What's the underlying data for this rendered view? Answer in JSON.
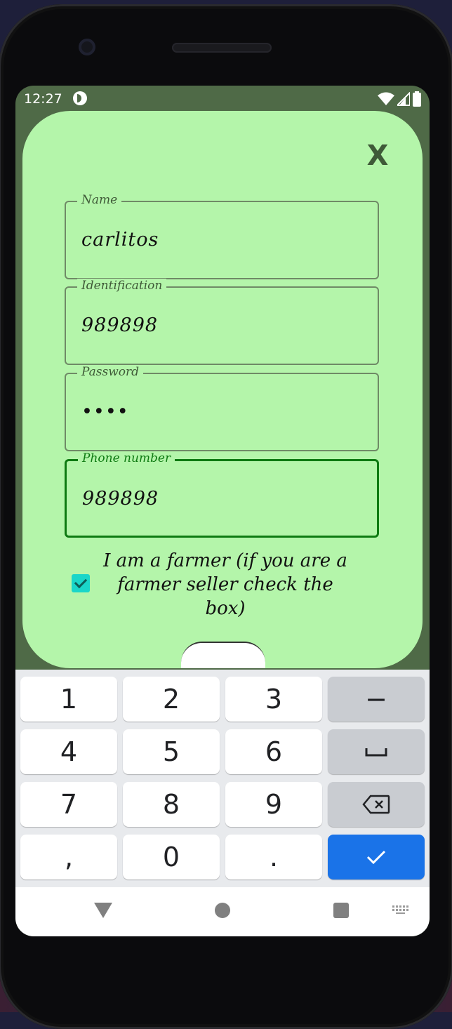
{
  "status_bar": {
    "time": "12:27"
  },
  "dialog": {
    "close_label": "X",
    "fields": [
      {
        "label": "Name",
        "value": "carlitos"
      },
      {
        "label": "Identification",
        "value": "989898"
      },
      {
        "label": "Password",
        "value": "••••"
      },
      {
        "label": "Phone number",
        "value": "989898"
      }
    ],
    "farmer_checkbox": {
      "checked": true,
      "label": "I am a farmer (if you are a farmer seller check the box)"
    }
  },
  "keyboard": {
    "rows": [
      [
        "1",
        "2",
        "3",
        "−"
      ],
      [
        "4",
        "5",
        "6",
        "␣"
      ],
      [
        "7",
        "8",
        "9",
        "⌫"
      ],
      [
        ",",
        "0",
        ".",
        "✓"
      ]
    ]
  },
  "colors": {
    "dialog_bg": "#b4f5aa",
    "focused_border": "#0e7a12",
    "checkbox": "#1ad6c9",
    "done_key": "#1a73e8"
  },
  "icons": {
    "status_app": "app-notification-icon",
    "wifi": "wifi-icon",
    "signal": "signal-icon",
    "battery": "battery-icon",
    "nav_back": "back-triangle-icon",
    "nav_home": "home-circle-icon",
    "nav_recents": "recents-square-icon",
    "nav_keyboard": "keyboard-icon"
  }
}
